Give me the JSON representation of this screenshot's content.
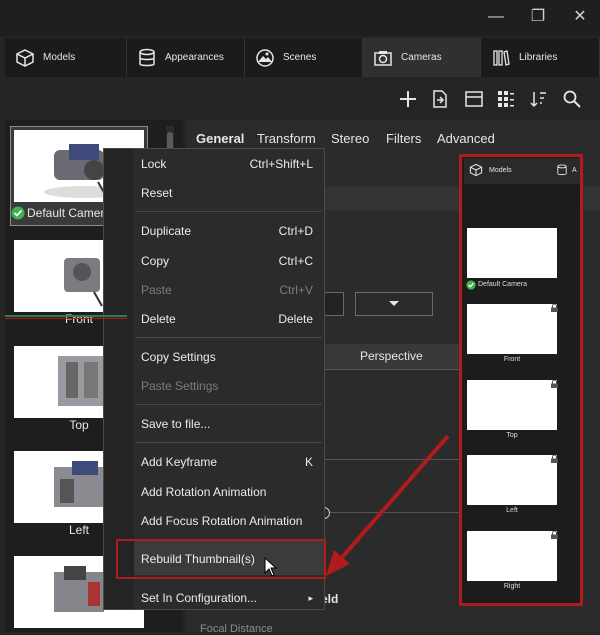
{
  "window": {
    "minimize": "—",
    "restore": "❐",
    "close": "✕"
  },
  "tabs": [
    {
      "label": "Models",
      "icon": "cube-icon"
    },
    {
      "label": "Appearances",
      "icon": "database-icon"
    },
    {
      "label": "Scenes",
      "icon": "landscape-icon"
    },
    {
      "label": "Cameras",
      "icon": "camera-icon"
    },
    {
      "label": "Libraries",
      "icon": "books-icon"
    }
  ],
  "toolbar": [
    "add-icon",
    "import-icon",
    "layout-icon",
    "grid-icon",
    "sort-icon",
    "search-icon"
  ],
  "thumbnails": [
    {
      "label": "Default Camera",
      "selected": true
    },
    {
      "label": "Front"
    },
    {
      "label": "Top"
    },
    {
      "label": "Left"
    },
    {
      "label": "Right"
    }
  ],
  "prop_tabs": [
    "General",
    "Transform",
    "Stereo",
    "Filters",
    "Advanced"
  ],
  "props": {
    "projection": "Perspective",
    "depth_field": "eld",
    "focal_distance": "Focal Distance"
  },
  "menu": {
    "items": [
      {
        "label": "Lock",
        "shortcut": "Ctrl+Shift+L"
      },
      {
        "label": "Reset",
        "shortcut": ""
      },
      {
        "label": "Duplicate",
        "shortcut": "Ctrl+D"
      },
      {
        "label": "Copy",
        "shortcut": "Ctrl+C"
      },
      {
        "label": "Paste",
        "shortcut": "Ctrl+V",
        "disabled": true
      },
      {
        "label": "Delete",
        "shortcut": "Delete"
      },
      {
        "label": "Copy Settings",
        "shortcut": ""
      },
      {
        "label": "Paste Settings",
        "shortcut": "",
        "disabled": true
      },
      {
        "label": "Save to file...",
        "shortcut": ""
      },
      {
        "label": "Add Keyframe",
        "shortcut": "K"
      },
      {
        "label": "Add Rotation Animation",
        "shortcut": ""
      },
      {
        "label": "Add Focus Rotation Animation",
        "shortcut": ""
      },
      {
        "label": "Rebuild Thumbnail(s)",
        "shortcut": ""
      },
      {
        "label": "Set In Configuration...",
        "shortcut": "▸"
      }
    ]
  },
  "preview": {
    "tabs": [
      "Models",
      "A"
    ],
    "items": [
      "Default Camera",
      "Front",
      "Top",
      "Left",
      "Right"
    ]
  },
  "colors": {
    "accent": "#4aa3df",
    "callout": "#b11b1b",
    "check": "#3cb44b"
  }
}
